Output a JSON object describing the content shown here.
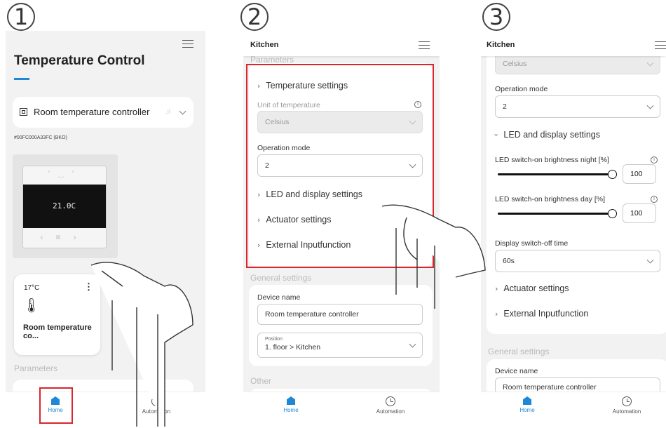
{
  "steps": [
    "1",
    "2",
    "3"
  ],
  "panel1": {
    "title": "Temperature Control",
    "device_select": "Room temperature controller",
    "device_id": "#00FC000A33FC (BKO)",
    "thermostat_display": "21.0C",
    "tile": {
      "temp": "17°C",
      "name": "Room temperature co..."
    },
    "section_parameters": "Parameters",
    "nav": {
      "home": "Home",
      "automation": "Automation"
    }
  },
  "panel2": {
    "header": "Kitchen",
    "section_parameters": "Parameters",
    "temperature_settings": "Temperature settings",
    "unit_label": "Unit of temperature",
    "unit_value": "Celsius",
    "operation_mode_label": "Operation mode",
    "operation_mode_value": "2",
    "led_settings": "LED and display settings",
    "actuator_settings": "Actuator settings",
    "external_input": "External Inputfunction",
    "general_settings": "General settings",
    "device_name_label": "Device name",
    "device_name_value": "Room temperature controller",
    "position_label": "Position",
    "position_value": "1. floor > Kitchen",
    "section_other": "Other",
    "nav": {
      "home": "Home",
      "automation": "Automation"
    }
  },
  "panel3": {
    "header": "Kitchen",
    "unit_value": "Celsius",
    "operation_mode_label": "Operation mode",
    "operation_mode_value": "2",
    "led_settings": "LED and display settings",
    "brightness_night_label": "LED switch-on brightness night [%]",
    "brightness_night_value": "100",
    "brightness_night_level": 1.0,
    "brightness_day_label": "LED switch-on brightness day [%]",
    "brightness_day_value": "100",
    "brightness_day_level": 1.0,
    "display_off_label": "Display switch-off time",
    "display_off_value": "60s",
    "actuator_settings": "Actuator settings",
    "external_input": "External Inputfunction",
    "general_settings": "General settings",
    "device_name_label": "Device name",
    "device_name_value": "Room temperature controller",
    "nav": {
      "home": "Home",
      "automation": "Automation"
    }
  },
  "colors": {
    "accent": "#1e88d6",
    "highlight": "#d9252b"
  }
}
